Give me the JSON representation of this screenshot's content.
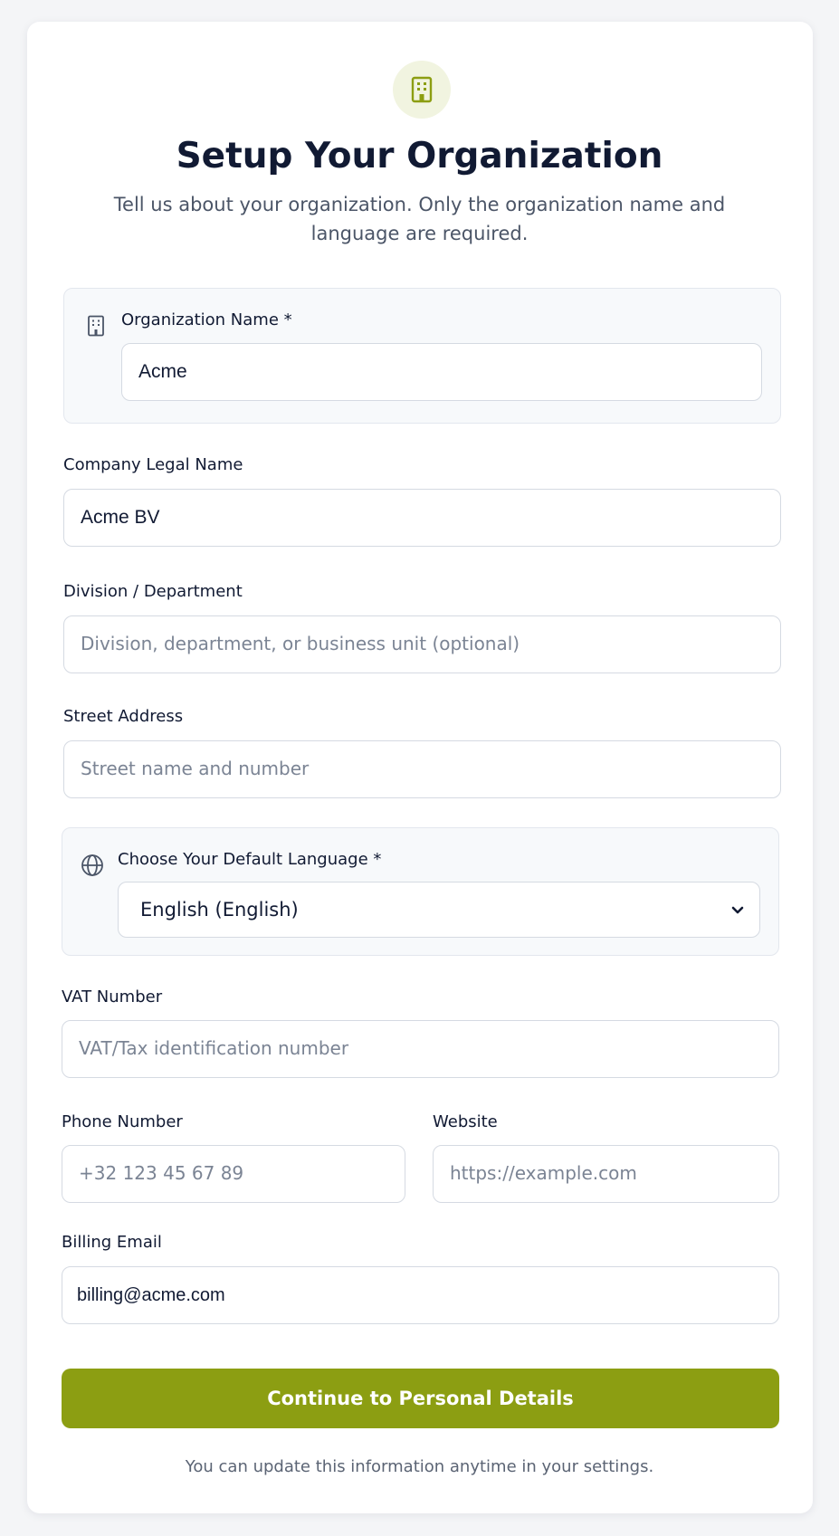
{
  "header": {
    "icon": "building-icon",
    "title": "Setup Your Organization",
    "subtitle": "Tell us about your organization. Only the organization name and language are required."
  },
  "fields": {
    "organization_name": {
      "label": "Organization Name *",
      "value": "Acme",
      "icon": "building-icon"
    },
    "company_legal_name": {
      "label": "Company Legal Name",
      "value": "Acme BV"
    },
    "division": {
      "label": "Division / Department",
      "placeholder": "Division, department, or business unit (optional)"
    },
    "street_address": {
      "label": "Street Address",
      "placeholder": "Street name and number"
    },
    "language": {
      "label": "Choose Your Default Language *",
      "value": "English (English)",
      "icon": "globe-icon"
    },
    "vat_number": {
      "label": "VAT Number",
      "placeholder": "VAT/Tax identification number"
    },
    "phone_number": {
      "label": "Phone Number",
      "placeholder": "+32 123 45 67 89"
    },
    "website": {
      "label": "Website",
      "placeholder": "https://example.com"
    },
    "billing_email": {
      "label": "Billing Email",
      "value": "billing@acme.com"
    }
  },
  "actions": {
    "continue_label": "Continue to Personal Details"
  },
  "footer": {
    "note": "You can update this information anytime in your settings."
  },
  "colors": {
    "accent": "#8c9e12",
    "accent_soft": "#f1f4e0",
    "text": "#111a33",
    "muted": "#4b5567"
  }
}
